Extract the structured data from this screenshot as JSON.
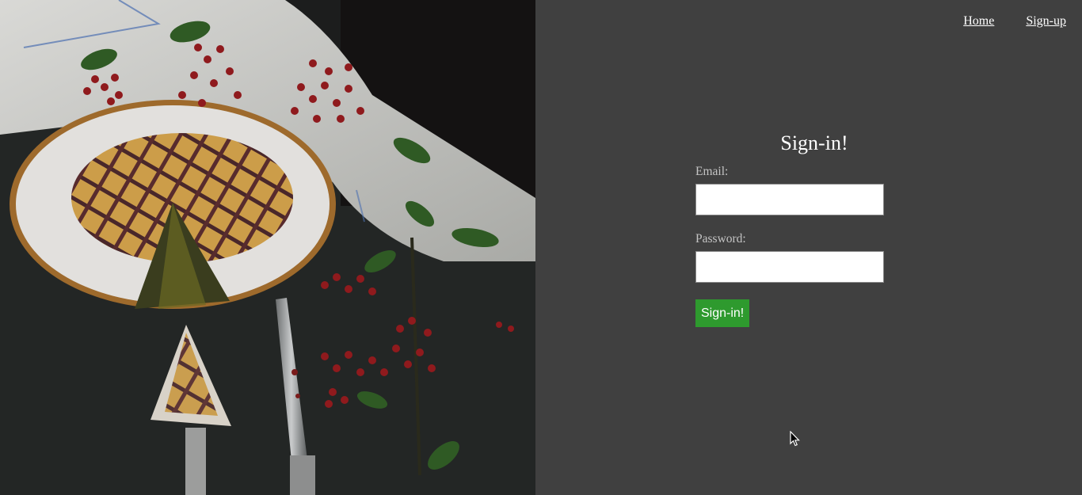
{
  "nav": {
    "home_label": "Home",
    "signup_label": "Sign-up"
  },
  "form": {
    "title": "Sign-in!",
    "email_label": "Email:",
    "email_value": "",
    "password_label": "Password:",
    "password_value": "",
    "submit_label": "Sign-in!"
  },
  "colors": {
    "panel_background": "#404040",
    "submit_button": "#2e9a2e",
    "text_primary": "#ffffff",
    "text_label": "#c4c4c4"
  },
  "icons": {
    "cursor": "mouse-pointer-icon"
  },
  "photo": {
    "subject": "lattice-tart-photo"
  }
}
